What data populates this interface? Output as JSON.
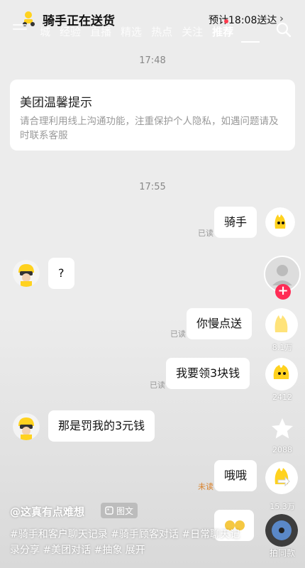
{
  "header": {
    "rider_status": "骑手正在送货",
    "eta": "预计18:08送达",
    "tabs": [
      "城",
      "经验",
      "直播",
      "精选",
      "热点",
      "关注",
      "推荐"
    ]
  },
  "chat": {
    "time_1": "17:48",
    "notice": {
      "title": "美团温馨提示",
      "body": "请合理利用线上沟通功能，注重保护个人隐私，如遇问题请及时联系客服"
    },
    "time_2": "17:55",
    "messages": [
      {
        "text": "骑手",
        "status": "已读"
      },
      {
        "text": "?"
      },
      {
        "text": "你慢点送",
        "status": "已读"
      },
      {
        "text": "我要领3块钱",
        "status": "已读"
      },
      {
        "text": "那是罚我的3元钱"
      },
      {
        "text": "哦哦",
        "status": "未读"
      }
    ]
  },
  "sidebar": {
    "like_count": "8.1万",
    "comment_count": "2412",
    "favorite_count": "2088",
    "share_count": "15.3万",
    "same_style_label": "拍同款"
  },
  "post": {
    "author": "@这真有点难想",
    "type_badge": "图文",
    "caption": "#骑手和客户聊天记录 #骑手顾客对话 #日常聊天记录分享 #美团对话 #抽象 展开"
  },
  "colors": {
    "accent": "#ff2c55",
    "unread": "#d9822b",
    "rider_yellow": "#ffd21f"
  }
}
